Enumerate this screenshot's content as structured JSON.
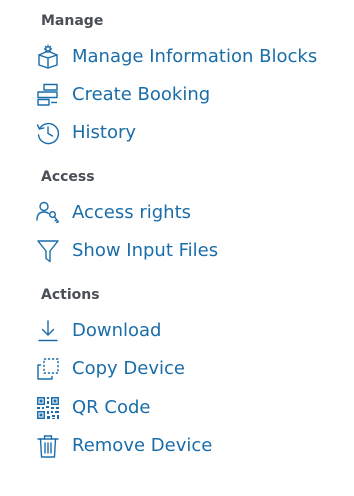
{
  "accent_color": "#1a6da8",
  "sections": {
    "manage": {
      "title": "Manage",
      "items": [
        {
          "label": "Manage Information Blocks",
          "icon": "gear-box-icon"
        },
        {
          "label": "Create Booking",
          "icon": "booking-icon"
        },
        {
          "label": "History",
          "icon": "history-icon"
        }
      ]
    },
    "access": {
      "title": "Access",
      "items": [
        {
          "label": "Access rights",
          "icon": "user-key-icon"
        },
        {
          "label": "Show Input Files",
          "icon": "filter-icon"
        }
      ]
    },
    "actions": {
      "title": "Actions",
      "items": [
        {
          "label": "Download",
          "icon": "download-icon"
        },
        {
          "label": "Copy Device",
          "icon": "copy-icon"
        },
        {
          "label": "QR Code",
          "icon": "qr-code-icon"
        },
        {
          "label": "Remove Device",
          "icon": "trash-icon"
        }
      ]
    }
  }
}
